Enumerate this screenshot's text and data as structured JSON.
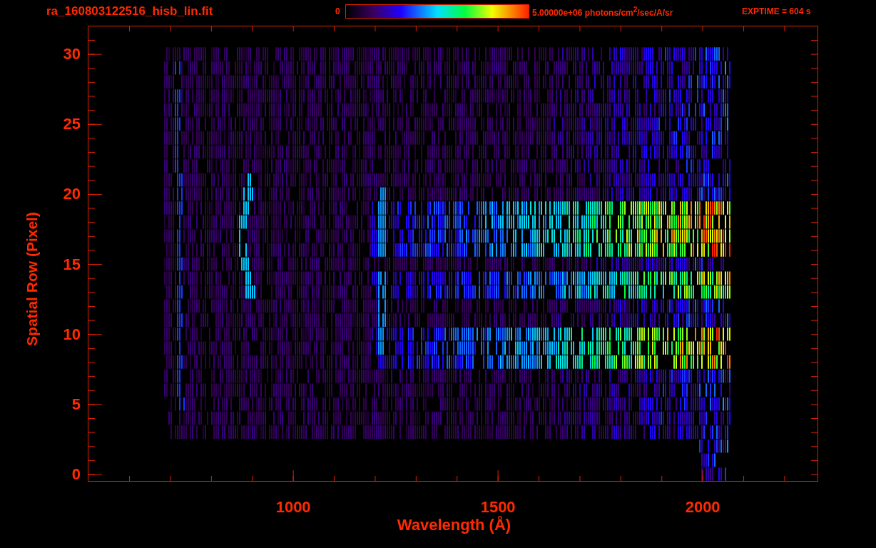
{
  "header": {
    "filename": "ra_160803122516_hisb_lin.fit",
    "colorbar_min": "0",
    "colorbar_max": "5.00000e+06 photons/cm$^{2}$/sec/A/sr",
    "exptime": "EXPTIME = 604 s"
  },
  "plot": {
    "ylabel": "Spatial Row (Pixel)",
    "xlabel": "Wavelength (Å)",
    "yticks": [
      "30",
      "25",
      "20",
      "15",
      "10",
      "5",
      "0"
    ],
    "xticks": [
      "1000",
      "1500",
      "2000"
    ]
  }
}
